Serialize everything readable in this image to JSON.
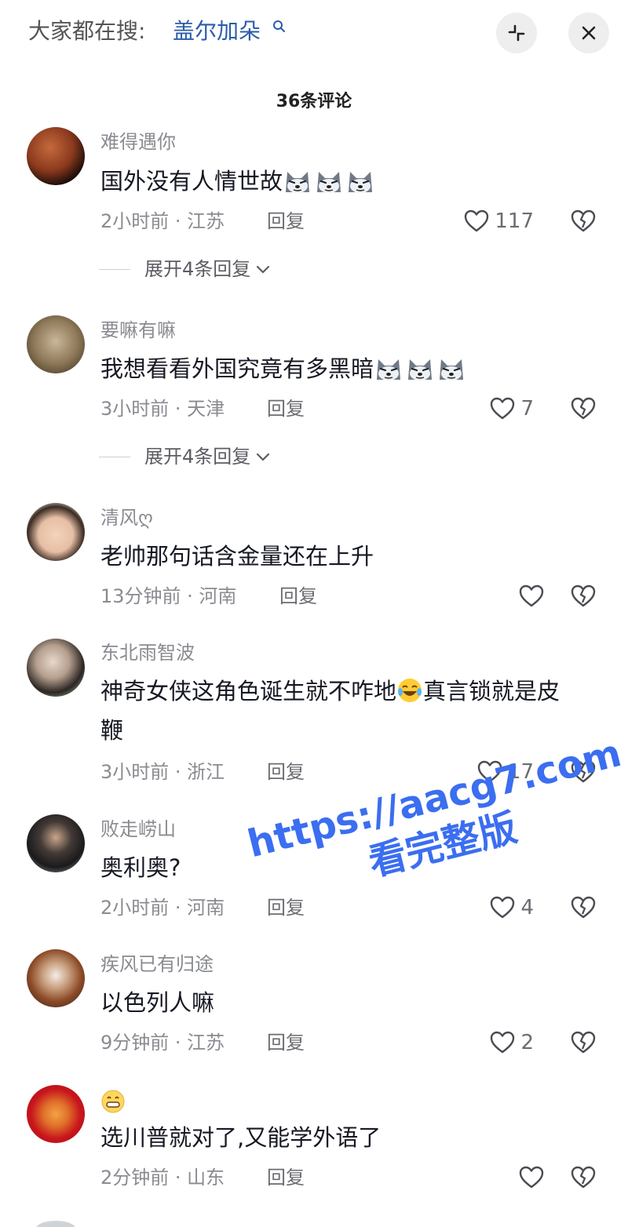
{
  "search": {
    "prefix": "大家都在搜:",
    "term": "盖尔加朵"
  },
  "comments_header": "36条评论",
  "comments": [
    {
      "username": "难得遇你",
      "text": "国外没有人情世故",
      "emoji_count": 3,
      "time": "2小时前 · 江苏",
      "reply_label": "回复",
      "likes": "117",
      "expand": "展开4条回复",
      "avatar": "planet-mars"
    },
    {
      "username": "要嘛有嘛",
      "text": "我想看看外国究竟有多黑暗",
      "emoji_count": 3,
      "time": "3小时前 · 天津",
      "reply_label": "回复",
      "likes": "7",
      "expand": "展开4条回复",
      "avatar": "sloth"
    },
    {
      "username": "清风ღ",
      "text": "老帅那句话含金量还在上升",
      "time": "13分钟前 · 河南",
      "reply_label": "回复",
      "likes": "",
      "avatar": "child"
    },
    {
      "username": "东北雨智波",
      "text_line1_a": "神奇女侠这角色诞生就不咋地",
      "text_line1_b": "真言锁就是皮",
      "text_line2": "鞭",
      "time": "3小时前 · 浙江",
      "reply_label": "回复",
      "likes": "17",
      "avatar": "young-man"
    },
    {
      "username": "败走崂山",
      "text": "奥利奥?",
      "time": "2小时前 · 河南",
      "reply_label": "回复",
      "likes": "4",
      "avatar": "police-officer"
    },
    {
      "username": "疾风已有归途",
      "text": "以色列人嘛",
      "time": "9分钟前 · 江苏",
      "reply_label": "回复",
      "likes": "2",
      "avatar": "red-panda"
    },
    {
      "username": "",
      "text": "选川普就对了,又能学外语了",
      "time": "2分钟前 · 山东",
      "reply_label": "回复",
      "likes": "",
      "avatar": "tiger-new-year"
    }
  ],
  "watermark": {
    "url": "https://aacg7.com",
    "sub": "看完整版"
  },
  "colors": {
    "link": "#2a5daa",
    "watermark": "#3b6ef0",
    "muted": "#8a8b91"
  },
  "icons": [
    "search-icon",
    "collapse-icon",
    "close-icon",
    "heart-icon",
    "broken-heart-icon",
    "chevron-down-icon",
    "husky-emoji",
    "laugh-cry-emoji",
    "grin-emoji"
  ]
}
